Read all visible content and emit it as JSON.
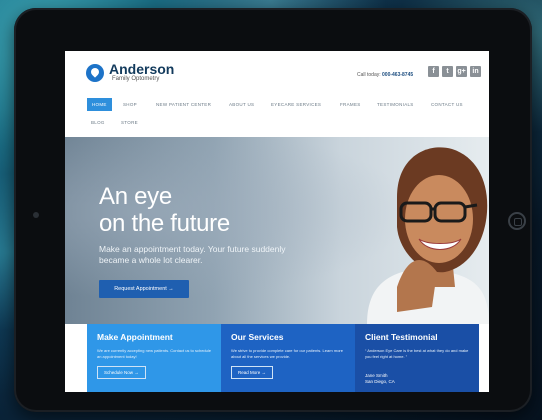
{
  "site": {
    "brand": "Anderson",
    "brand_sub": "Family Optometry",
    "call_label": "Call today:",
    "call_number": "000-463-8745",
    "social": [
      "f",
      "t",
      "g+",
      "in"
    ]
  },
  "nav": {
    "items": [
      "HOME",
      "SHOP",
      "NEW PATIENT CENTER",
      "ABOUT US",
      "EYECARE SERVICES",
      "FRAMES",
      "TESTIMONIALS",
      "CONTACT US"
    ],
    "row2": [
      "BLOG",
      "STORE"
    ]
  },
  "hero": {
    "title_line1": "An eye",
    "title_line2": "on the future",
    "subtitle": "Make an appointment today. Your future suddenly became a whole lot clearer.",
    "button": "Request Appointment →"
  },
  "panels": {
    "appointment": {
      "title": "Make Appointment",
      "text": "We are currently accepting new patients. Contact us to schedule an appointment today!",
      "button": "Schedule Now →"
    },
    "services": {
      "title": "Our Services",
      "text": "We strive to provide complete care for our patients. Learn more about all the services we provide.",
      "button": "Read More →"
    },
    "testimonial": {
      "title": "Client Testimonial",
      "quote": "“ Anderson Eye Care is the best at what they do and make you feel right at home. ”",
      "name": "Jane Smith",
      "location": "San Diego, CA"
    }
  },
  "colors": {
    "accent": "#2e8fdc",
    "brand_dark": "#123a5c",
    "panel_light": "#2f97e8",
    "panel_mid": "#1e63c3",
    "panel_dark": "#1a4fa6"
  }
}
